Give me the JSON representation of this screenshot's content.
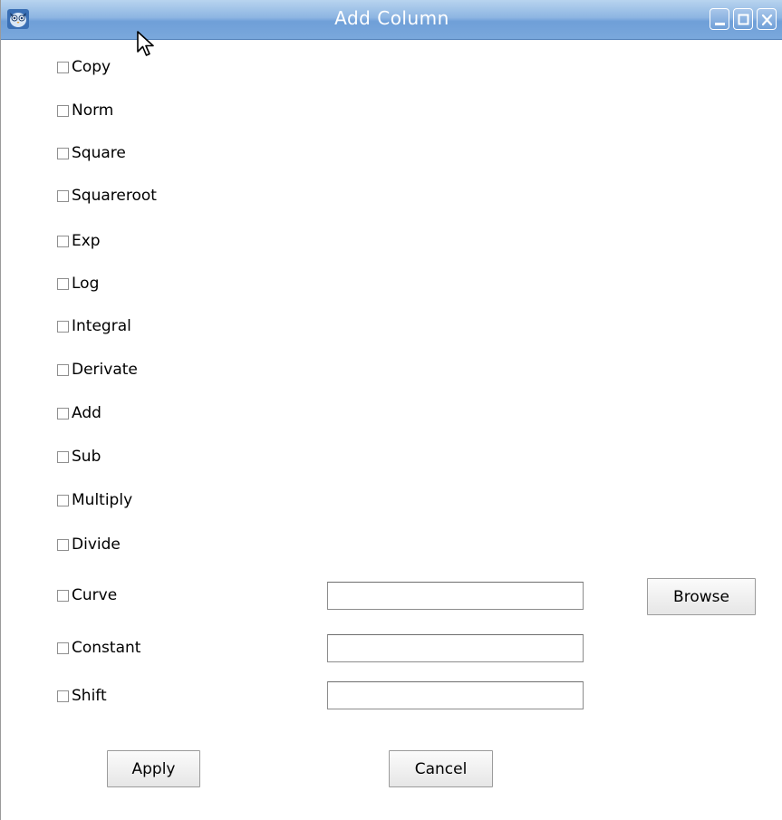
{
  "window": {
    "title": "Add Column",
    "icons": {
      "app": "owl-app-icon",
      "minimize": "minimize-icon",
      "maximize": "maximize-icon",
      "close": "close-icon"
    },
    "colors": {
      "titlebar": "#7aa8dc",
      "title_text": "#ffffff"
    }
  },
  "options": [
    {
      "label": "Copy",
      "checked": false
    },
    {
      "label": "Norm",
      "checked": false
    },
    {
      "label": "Square",
      "checked": false
    },
    {
      "label": "Squareroot",
      "checked": false
    },
    {
      "label": "Exp",
      "checked": false
    },
    {
      "label": "Log",
      "checked": false
    },
    {
      "label": "Integral",
      "checked": false
    },
    {
      "label": "Derivate",
      "checked": false
    },
    {
      "label": "Add",
      "checked": false
    },
    {
      "label": "Sub",
      "checked": false
    },
    {
      "label": "Multiply",
      "checked": false
    },
    {
      "label": "Divide",
      "checked": false
    },
    {
      "label": "Curve",
      "checked": false
    },
    {
      "label": "Constant",
      "checked": false
    },
    {
      "label": "Shift",
      "checked": false
    }
  ],
  "fields": {
    "curve": {
      "value": ""
    },
    "constant": {
      "value": ""
    },
    "shift": {
      "value": ""
    }
  },
  "buttons": {
    "browse": "Browse",
    "apply": "Apply",
    "cancel": "Cancel"
  }
}
